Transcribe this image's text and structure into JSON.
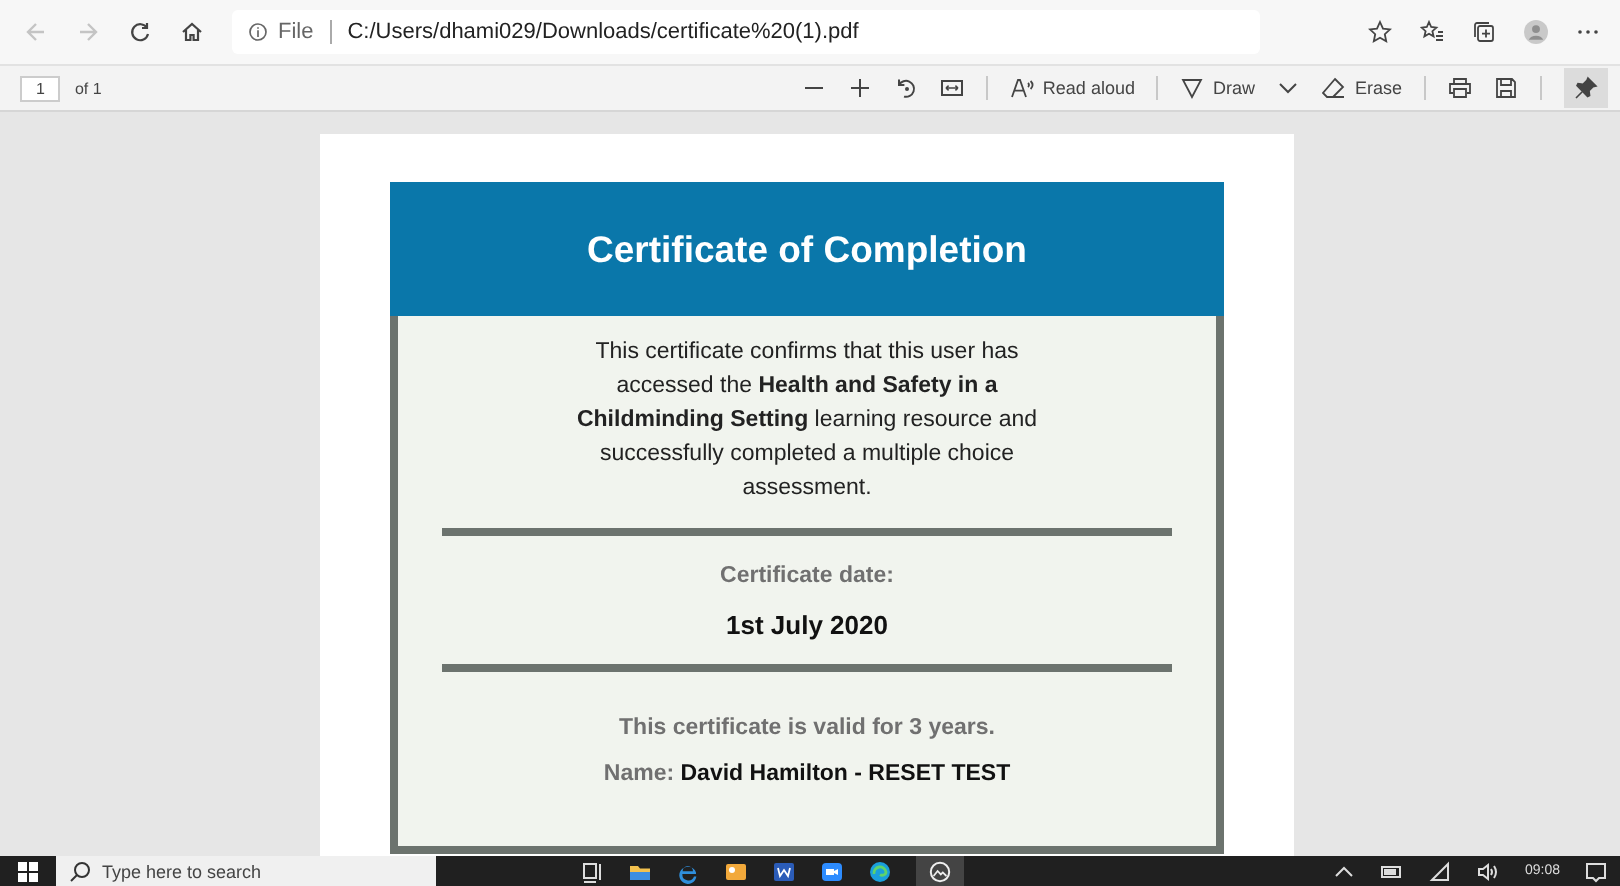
{
  "address_bar": {
    "scheme_label": "File",
    "url": "C:/Users/dhami029/Downloads/certificate%20(1).pdf"
  },
  "pdf_toolbar": {
    "page_number": "1",
    "page_count": "of 1",
    "read_aloud": "Read aloud",
    "draw": "Draw",
    "erase": "Erase"
  },
  "certificate": {
    "title": "Certificate of Completion",
    "statement": "This certificate confirms that this user has accessed the **Health and Safety in a Childminding Setting** learning resource and successfully completed a multiple choice assessment.",
    "date_label": "Certificate date:",
    "date": "1st July 2020",
    "validity": "This certificate is valid for 3 years.",
    "name_label": "Name:",
    "name": "David Hamilton - RESET TEST"
  },
  "taskbar": {
    "search_placeholder": "Type here to search",
    "clock": "09:08"
  }
}
